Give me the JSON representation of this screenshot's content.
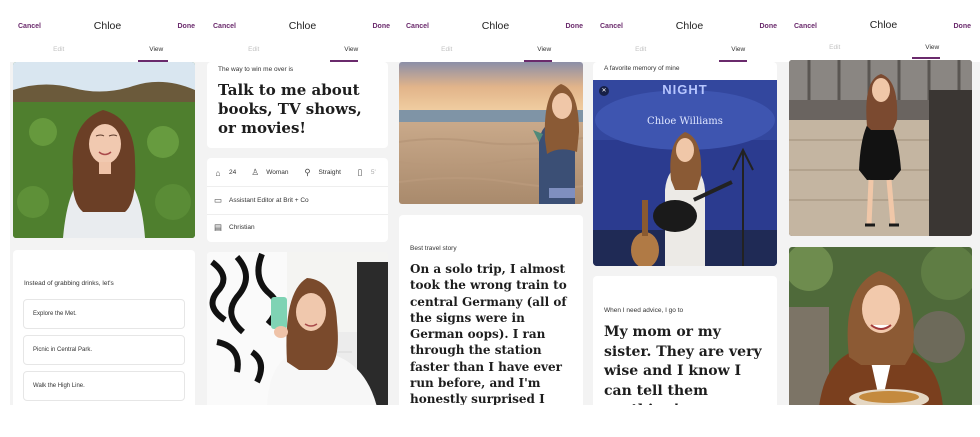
{
  "header": {
    "cancel": "Cancel",
    "done": "Done",
    "name": "Chloe",
    "tab_edit": "Edit",
    "tab_view": "View"
  },
  "screen1": {
    "prompt_question": "Instead of grabbing drinks, let's",
    "options": [
      "Explore the Met.",
      "Picnic in Central Park.",
      "Walk the High Line."
    ]
  },
  "screen2": {
    "prompt_question": "The way to win me over is",
    "prompt_answer": "Talk to me about books, TV shows, or movies!",
    "vitals": {
      "age": "24",
      "gender": "Woman",
      "orientation": "Straight",
      "height": "5'",
      "job": "Assistant Editor at Brit + Co",
      "religion": "Christian"
    }
  },
  "screen3": {
    "prompt_question": "Best travel story",
    "prompt_answer": "On a solo trip, I almost took the wrong train to central Germany (all of the signs were in German oops). I ran through the station faster than I have ever run before, and I'm honestly surprised I didn't fall down the stairs."
  },
  "screen4": {
    "prompt_question": "A favorite memory of mine",
    "banner_top": "NIGHT",
    "banner_name": "Chloe Williams",
    "prompt2_question": "When I need advice, I go to",
    "prompt2_answer": "My mom or my sister. They are very wise and I know I can tell them anything!"
  },
  "icons": {
    "age": "cake-icon",
    "gender": "person-icon",
    "orientation": "orientation-icon",
    "height": "ruler-icon",
    "job": "briefcase-icon",
    "religion": "book-icon",
    "mute": "mute-icon"
  },
  "colors": {
    "accent": "#6a2a6c",
    "background": "#f3f3f3",
    "card": "#ffffff"
  }
}
